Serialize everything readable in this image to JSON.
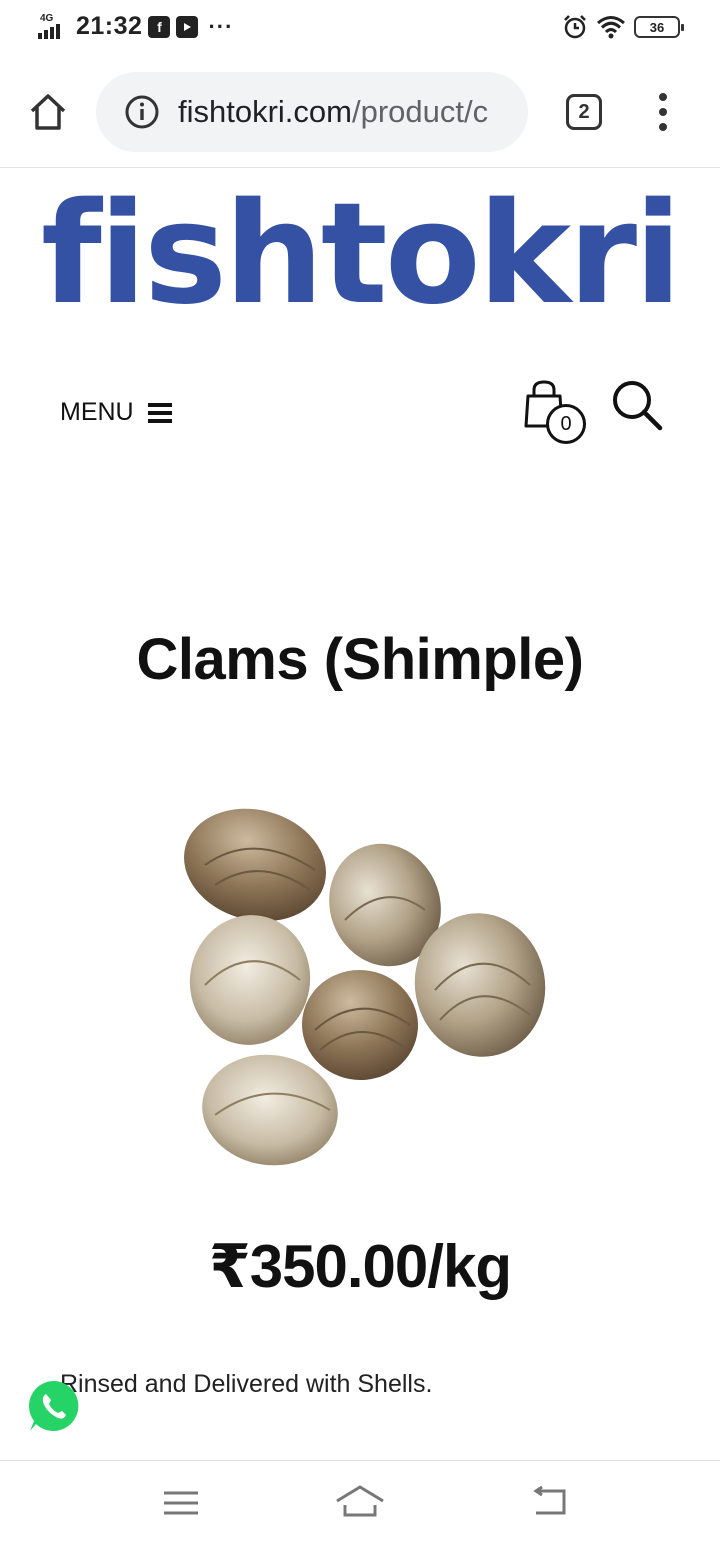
{
  "status_bar": {
    "network": "4G",
    "time": "21:32",
    "notification_icons": [
      "facebook-icon",
      "youtube-icon"
    ],
    "overflow": "···",
    "battery": "36"
  },
  "browser": {
    "url_domain": "fishtokri.com",
    "url_path": "/product/c",
    "tab_count": "2"
  },
  "site": {
    "logo": "fishtokri",
    "brand_color": "#3451a3",
    "menu_label": "MENU",
    "cart_count": "0"
  },
  "product": {
    "title": "Clams (Shimple)",
    "price": "₹350.00/kg",
    "description": "Rinsed and Delivered with Shells."
  },
  "nav": {
    "buttons": [
      "menu-icon",
      "home-icon",
      "back-icon"
    ]
  }
}
